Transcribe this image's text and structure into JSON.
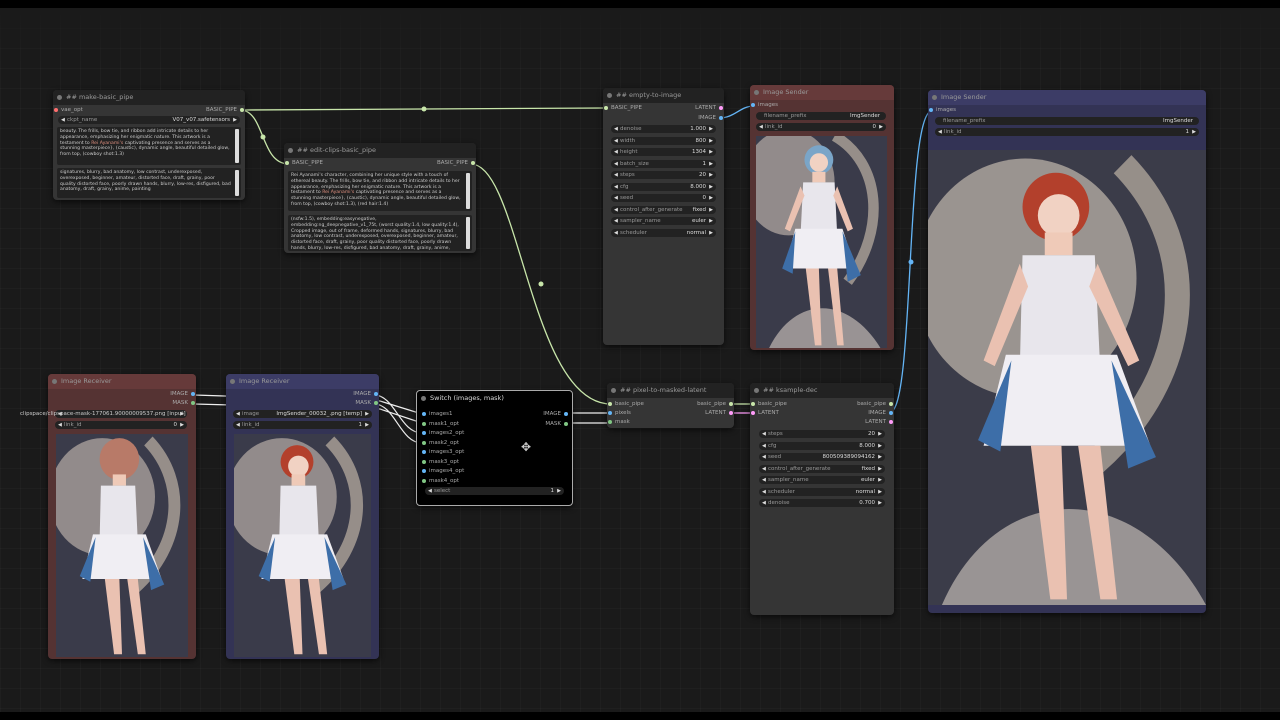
{
  "nodes": {
    "make_basic_pipe": {
      "title": "## make-basic_pipe",
      "input": "vae_opt",
      "output": "BASIC_PIPE",
      "ckpt_label": "ckpt_name",
      "ckpt_value": "V07_v07.safetensors",
      "positive_a": "beauty. The frills, bow tie, and ribbon add intricate details to her appearance, emphasizing her enigmatic nature. This artwork is a testament to ",
      "positive_hl": "Rei Ayanami's",
      "positive_b": " captivating presence and serves as a stunning masterpiece}, (caustic), dynamic angle, beautiful detailed glow, from top, (cowboy shot:1.3)",
      "negative": "signatures, blurry, bad anatomy, low contrast, underexposed, overexposed, beginner, amateur, distorted face, draft, grainy, poor quality distorted face, poorly drawn hands, blurry, low-res, disfigured, bad anatomy, draft, grainy, anime, painting"
    },
    "edit_clips": {
      "title": "## edit-clips-basic_pipe",
      "input": "BASIC_PIPE",
      "output": "BASIC_PIPE",
      "positive_a": "Rei Ayanami's character, combining her unique style with a touch of ethereal beauty. The frills, bow tie, and ribbon add intricate details to her appearance, emphasizing her enigmatic nature. This artwork is a testament to ",
      "positive_hl": "Rei Ayanami's",
      "positive_b": " captivating presence and serves as a stunning masterpiece}, (caustic), dynamic angle, beautiful detailed glow, from top, (cowboy shot:1.3), (red hair:1.4)",
      "negative": "(nsfw:1.5), embedding:easynegative, embedding:ng_deepnegative_v1_75t, (worst quality:1.4, low quality:1.4), Cropped image, out of frame, deformed hands, signatures, blurry, bad anatomy, low contrast, underexposed, overexposed, beginner, amateur, distorted face, draft, grainy, poor quality distorted face, poorly drawn hands, blurry, low-res, disfigured, bad anatomy, draft, grainy, anime,"
    },
    "empty_to_image": {
      "title": "## empty-to-image",
      "input": "BASIC_PIPE",
      "outputs": [
        "LATENT",
        "IMAGE"
      ],
      "widgets": [
        {
          "label": "denoise",
          "value": "1.000"
        },
        {
          "label": "width",
          "value": "800"
        },
        {
          "label": "height",
          "value": "1304"
        },
        {
          "label": "batch_size",
          "value": "1"
        },
        {
          "label": "steps",
          "value": "20"
        },
        {
          "label": "cfg",
          "value": "8.000"
        },
        {
          "label": "seed",
          "value": "0"
        },
        {
          "label": "control_after_generate",
          "value": "fixed"
        },
        {
          "label": "sampler_name",
          "value": "euler"
        },
        {
          "label": "scheduler",
          "value": "normal"
        }
      ]
    },
    "image_sender_1": {
      "title": "Image Sender",
      "input": "images",
      "prefix_label": "filename_prefix",
      "prefix_value": "ImgSender",
      "link_label": "link_id",
      "link_value": "0"
    },
    "image_sender_2": {
      "title": "Image Sender",
      "input": "images",
      "prefix_label": "filename_prefix",
      "prefix_value": "ImgSender",
      "link_label": "link_id",
      "link_value": "1"
    },
    "image_receiver_1": {
      "title": "Image Receiver",
      "outputs": [
        "IMAGE",
        "MASK"
      ],
      "external_label": "clipspace/clipspace-mask-177061.90000009537.png [input]",
      "link_label": "link_id",
      "link_value": "0"
    },
    "image_receiver_2": {
      "title": "Image Receiver",
      "outputs": [
        "IMAGE",
        "MASK"
      ],
      "image_label": "image",
      "image_value": "ImgSender_00032_.png [temp]",
      "link_label": "link_id",
      "link_value": "1"
    },
    "switch": {
      "title": "Switch (images, mask)",
      "inputs": [
        "images1",
        "mask1_opt",
        "images2_opt",
        "mask2_opt",
        "images3_opt",
        "mask3_opt",
        "images4_opt",
        "mask4_opt"
      ],
      "outputs": [
        "IMAGE",
        "MASK"
      ],
      "select_label": "select",
      "select_value": "1"
    },
    "pixel_to_masked": {
      "title": "## pixel-to-masked-latent",
      "inputs": [
        "basic_pipe",
        "pixels",
        "mask"
      ],
      "outputs": [
        "basic_pipe",
        "LATENT"
      ]
    },
    "ksample_dec": {
      "title": "## ksample-dec",
      "inputs": [
        "basic_pipe",
        "LATENT"
      ],
      "outputs": [
        "basic_pipe",
        "IMAGE",
        "LATENT"
      ],
      "widgets": [
        {
          "label": "steps",
          "value": "20"
        },
        {
          "label": "cfg",
          "value": "8.000"
        },
        {
          "label": "seed",
          "value": "800509389094162"
        },
        {
          "label": "control_after_generate",
          "value": "fixed"
        },
        {
          "label": "sampler_name",
          "value": "euler"
        },
        {
          "label": "scheduler",
          "value": "normal"
        },
        {
          "label": "denoise",
          "value": "0.700"
        }
      ]
    }
  },
  "icons": {
    "cursor": "move-cursor-icon"
  },
  "colors": {
    "pipe_wire": "#c8e6aa",
    "image_wire": "#64b5f6",
    "latent_wire": "#ff9cf9",
    "mask_wire": "#81c784",
    "red_node": "#553333",
    "blue_node": "#333355"
  }
}
